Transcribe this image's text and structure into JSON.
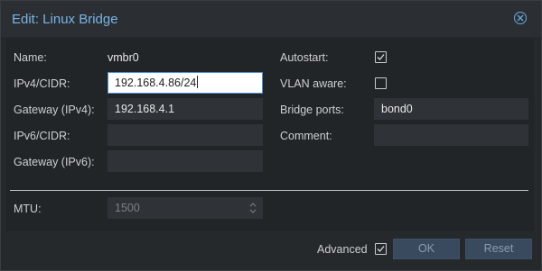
{
  "window": {
    "title": "Edit: Linux Bridge"
  },
  "form": {
    "name_label": "Name:",
    "name_value": "vmbr0",
    "ipv4_label": "IPv4/CIDR:",
    "ipv4_value": "192.168.4.86/24",
    "gateway4_label": "Gateway (IPv4):",
    "gateway4_value": "192.168.4.1",
    "ipv6_label": "IPv6/CIDR:",
    "ipv6_value": "",
    "gateway6_label": "Gateway (IPv6):",
    "gateway6_value": "",
    "autostart_label": "Autostart:",
    "autostart_checked": true,
    "vlan_label": "VLAN aware:",
    "vlan_checked": false,
    "bridge_ports_label": "Bridge ports:",
    "bridge_ports_value": "bond0",
    "comment_label": "Comment:",
    "comment_value": "",
    "mtu_label": "MTU:",
    "mtu_value": "1500"
  },
  "footer": {
    "advanced_label": "Advanced",
    "advanced_checked": true,
    "ok_label": "OK",
    "reset_label": "Reset"
  },
  "colors": {
    "accent": "#78b4e6",
    "background": "#26292c",
    "field_bg": "#2f3337",
    "button_bg": "#3a4a5e"
  },
  "icons": {
    "close": "close-circle-icon",
    "check": "checkmark-icon",
    "spinner": "spinner-arrows-icon"
  }
}
